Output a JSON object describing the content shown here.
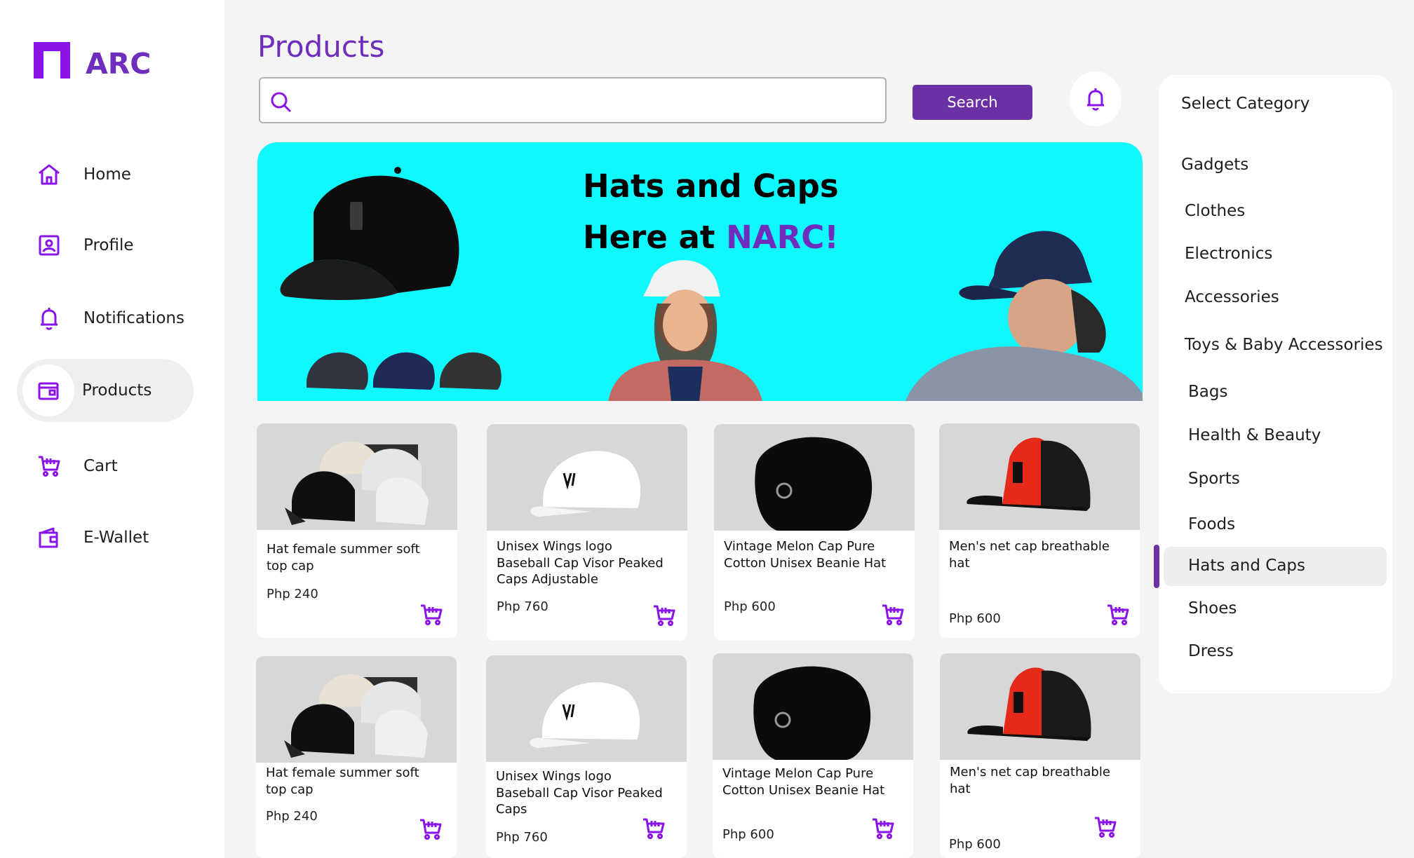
{
  "brand": {
    "name": "ARC"
  },
  "colors": {
    "accent": "#6f2dbd",
    "banner_bg": "#0ef8fe",
    "button": "#6b31a4"
  },
  "sidebar": {
    "items": [
      {
        "label": "Home",
        "icon": "home-icon"
      },
      {
        "label": "Profile",
        "icon": "profile-icon"
      },
      {
        "label": "Notifications",
        "icon": "bell-icon"
      },
      {
        "label": "Products",
        "icon": "products-icon",
        "active": true
      },
      {
        "label": "Cart",
        "icon": "cart-icon"
      },
      {
        "label": "E-Wallet",
        "icon": "wallet-icon"
      }
    ]
  },
  "header": {
    "title": "Products",
    "search": {
      "placeholder": "",
      "value": "",
      "button_label": "Search"
    },
    "notification_icon": "bell-icon"
  },
  "banner": {
    "line1": "Hats and Caps",
    "line2_prefix": "Here at ",
    "line2_accent": "NARC!"
  },
  "categories": {
    "title": "Select Category",
    "items": [
      "Gadgets",
      "Clothes",
      "Electronics",
      "Accessories",
      "Toys & Baby Accessories",
      "Bags",
      "Health & Beauty",
      "Sports",
      "Foods",
      "Hats and Caps",
      "Shoes",
      "Dress"
    ],
    "selected": "Hats and Caps"
  },
  "products": [
    {
      "name": "Hat female summer soft top cap",
      "price": "Php 240",
      "image": "cap-set-image"
    },
    {
      "name": "Unisex Wings logo Baseball Cap Visor Peaked Caps Adjustable",
      "price": "Php 760",
      "image": "white-cap-image"
    },
    {
      "name": "Vintage Melon Cap Pure Cotton Unisex Beanie Hat",
      "price": "Php 600",
      "image": "black-melon-cap-image"
    },
    {
      "name": "Men's net cap breathable hat",
      "price": "Php 600",
      "image": "red-net-cap-image"
    },
    {
      "name": "Hat female summer soft top cap",
      "price": "Php 240",
      "image": "cap-set-image"
    },
    {
      "name": "Unisex Wings logo Baseball Cap Visor Peaked Caps",
      "price": "Php 760",
      "image": "white-cap-image"
    },
    {
      "name": "Vintage Melon Cap Pure Cotton Unisex Beanie Hat",
      "price": "Php 600",
      "image": "black-melon-cap-image"
    },
    {
      "name": "Men's net cap breathable hat",
      "price": "Php 600",
      "image": "red-net-cap-image"
    }
  ]
}
